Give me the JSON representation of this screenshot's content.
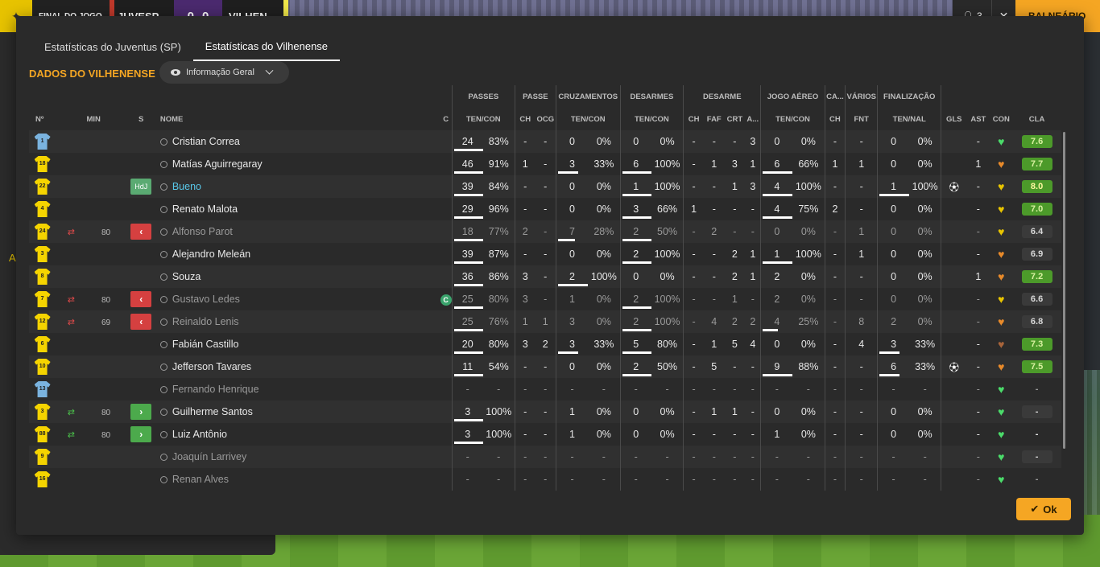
{
  "topbar": {
    "status": "FINAL DO JOGO",
    "home": "JUVESP",
    "home_score": "0",
    "away_score": "0",
    "away": "VILHEN",
    "people_count": "3",
    "dressing_room": "BALNEÁRIO"
  },
  "side_letter": "A",
  "tabs": [
    "Estatísticas do Juventus (SP)",
    "Estatísticas do Vilhenense"
  ],
  "active_tab": 1,
  "section_title": "DADOS DO VILHENENSE",
  "view_select": "Informação Geral",
  "group_headers": {
    "passes": "PASSES",
    "passe": "PASSE",
    "cruz": "CRUZAMENTOS",
    "desarmes": "DESARMES",
    "desarme": "DESARME",
    "aereo": "JOGO AÉREO",
    "ca": "CA...",
    "varios": "VÁRIOS",
    "final": "FINALIZAÇÃO"
  },
  "col_headers": {
    "n": "Nº",
    "min": "MIN",
    "s": "S",
    "nome": "NOME",
    "c": "C",
    "passes": "TEN/CON",
    "ch": "CH",
    "ocg": "OCG",
    "cruz": "TEN/CON",
    "des": "TEN/CON",
    "dch": "CH",
    "faf": "FAF",
    "crt": "CRT",
    "a": "A...",
    "aereo": "TEN/CON",
    "cach": "CH",
    "fnt": "FNT",
    "fin": "TEN/NAL",
    "gls": "GLS",
    "ast": "AST",
    "con": "CON",
    "cla": "CLA"
  },
  "players": [
    {
      "n": "1",
      "gk": true,
      "sub": "",
      "min": "",
      "s": "",
      "name": "Cristian Correa",
      "cap": false,
      "passes": [
        "24",
        "83%"
      ],
      "pbar": 83,
      "passe": [
        "-",
        "-"
      ],
      "cruz": [
        "0",
        "0%"
      ],
      "cbar": 0,
      "des": [
        "0",
        "0%"
      ],
      "dbar": 0,
      "desarme": [
        "-",
        "-",
        "-",
        "3"
      ],
      "aereo": [
        "0",
        "0%"
      ],
      "abar": 0,
      "ca": "-",
      "varios": "-",
      "fin": [
        "0",
        "0%"
      ],
      "fbar": 0,
      "gls": "",
      "ast": "-",
      "con": "green",
      "cla": "7.6",
      "clat": "good",
      "dim": false
    },
    {
      "n": "18",
      "gk": false,
      "sub": "",
      "min": "",
      "s": "",
      "name": "Matías Aguirregaray",
      "cap": false,
      "passes": [
        "46",
        "91%"
      ],
      "pbar": 91,
      "passe": [
        "1",
        "-"
      ],
      "cruz": [
        "3",
        "33%"
      ],
      "cbar": 33,
      "des": [
        "6",
        "100%"
      ],
      "dbar": 100,
      "desarme": [
        "-",
        "1",
        "3",
        "1"
      ],
      "aereo": [
        "6",
        "66%"
      ],
      "abar": 66,
      "ca": "1",
      "varios": "1",
      "fin": [
        "0",
        "0%"
      ],
      "fbar": 0,
      "gls": "",
      "ast": "1",
      "con": "orange",
      "cla": "7.7",
      "clat": "good",
      "dim": false
    },
    {
      "n": "22",
      "gk": false,
      "sub": "",
      "min": "",
      "s": "HdJ",
      "name": "Bueno",
      "cap": false,
      "blue": true,
      "passes": [
        "39",
        "84%"
      ],
      "pbar": 84,
      "passe": [
        "-",
        "-"
      ],
      "cruz": [
        "0",
        "0%"
      ],
      "cbar": 0,
      "des": [
        "1",
        "100%"
      ],
      "dbar": 100,
      "desarme": [
        "-",
        "-",
        "1",
        "3"
      ],
      "aereo": [
        "4",
        "100%"
      ],
      "abar": 100,
      "ca": "-",
      "varios": "-",
      "fin": [
        "1",
        "100%"
      ],
      "fbar": 100,
      "gls": "ball",
      "ast": "-",
      "con": "yellow",
      "cla": "8.0",
      "clat": "best",
      "dim": false
    },
    {
      "n": "4",
      "gk": false,
      "sub": "",
      "min": "",
      "s": "",
      "name": "Renato Malota",
      "cap": false,
      "passes": [
        "29",
        "96%"
      ],
      "pbar": 96,
      "passe": [
        "-",
        "-"
      ],
      "cruz": [
        "0",
        "0%"
      ],
      "cbar": 0,
      "des": [
        "3",
        "66%"
      ],
      "dbar": 66,
      "desarme": [
        "1",
        "-",
        "-",
        "-"
      ],
      "aereo": [
        "4",
        "75%"
      ],
      "abar": 75,
      "ca": "2",
      "varios": "-",
      "fin": [
        "0",
        "0%"
      ],
      "fbar": 0,
      "gls": "",
      "ast": "-",
      "con": "yellow",
      "cla": "7.0",
      "clat": "good",
      "dim": false
    },
    {
      "n": "24",
      "gk": false,
      "sub": "out",
      "min": "80",
      "s": "out",
      "name": "Alfonso Parot",
      "cap": false,
      "passes": [
        "18",
        "77%"
      ],
      "pbar": 77,
      "passe": [
        "2",
        "-"
      ],
      "cruz": [
        "7",
        "28%"
      ],
      "cbar": 28,
      "des": [
        "2",
        "50%"
      ],
      "dbar": 50,
      "desarme": [
        "-",
        "2",
        "-",
        "-"
      ],
      "aereo": [
        "0",
        "0%"
      ],
      "abar": 0,
      "ca": "-",
      "varios": "1",
      "fin": [
        "0",
        "0%"
      ],
      "fbar": 0,
      "gls": "",
      "ast": "-",
      "con": "yellow",
      "cla": "6.4",
      "clat": "mid",
      "dim": true
    },
    {
      "n": "3",
      "gk": false,
      "sub": "",
      "min": "",
      "s": "",
      "name": "Alejandro Meleán",
      "cap": false,
      "passes": [
        "39",
        "87%"
      ],
      "pbar": 87,
      "passe": [
        "-",
        "-"
      ],
      "cruz": [
        "0",
        "0%"
      ],
      "cbar": 0,
      "des": [
        "2",
        "100%"
      ],
      "dbar": 100,
      "desarme": [
        "-",
        "-",
        "2",
        "1"
      ],
      "aereo": [
        "1",
        "100%"
      ],
      "abar": 100,
      "ca": "-",
      "varios": "1",
      "fin": [
        "0",
        "0%"
      ],
      "fbar": 0,
      "gls": "",
      "ast": "-",
      "con": "orange",
      "cla": "6.9",
      "clat": "mid",
      "dim": false
    },
    {
      "n": "8",
      "gk": false,
      "sub": "",
      "min": "",
      "s": "",
      "name": "Souza",
      "cap": false,
      "passes": [
        "36",
        "86%"
      ],
      "pbar": 86,
      "passe": [
        "3",
        "-"
      ],
      "cruz": [
        "2",
        "100%"
      ],
      "cbar": 100,
      "des": [
        "0",
        "0%"
      ],
      "dbar": 0,
      "desarme": [
        "-",
        "-",
        "2",
        "1"
      ],
      "aereo": [
        "2",
        "0%"
      ],
      "abar": 0,
      "ca": "-",
      "varios": "-",
      "fin": [
        "0",
        "0%"
      ],
      "fbar": 0,
      "gls": "",
      "ast": "1",
      "con": "orange",
      "cla": "7.2",
      "clat": "good",
      "dim": false
    },
    {
      "n": "7",
      "gk": false,
      "sub": "out",
      "min": "80",
      "s": "out",
      "name": "Gustavo Ledes",
      "cap": true,
      "passes": [
        "25",
        "80%"
      ],
      "pbar": 80,
      "passe": [
        "3",
        "-"
      ],
      "cruz": [
        "1",
        "0%"
      ],
      "cbar": 0,
      "des": [
        "2",
        "100%"
      ],
      "dbar": 100,
      "desarme": [
        "-",
        "-",
        "1",
        "-"
      ],
      "aereo": [
        "2",
        "0%"
      ],
      "abar": 0,
      "ca": "-",
      "varios": "-",
      "fin": [
        "0",
        "0%"
      ],
      "fbar": 0,
      "gls": "",
      "ast": "-",
      "con": "yellow",
      "cla": "6.6",
      "clat": "mid",
      "dim": true
    },
    {
      "n": "12",
      "gk": false,
      "sub": "out",
      "min": "69",
      "s": "out",
      "name": "Reinaldo Lenis",
      "cap": false,
      "passes": [
        "25",
        "76%"
      ],
      "pbar": 76,
      "passe": [
        "1",
        "1"
      ],
      "cruz": [
        "3",
        "0%"
      ],
      "cbar": 0,
      "des": [
        "2",
        "100%"
      ],
      "dbar": 100,
      "desarme": [
        "-",
        "4",
        "2",
        "2"
      ],
      "aereo": [
        "4",
        "25%"
      ],
      "abar": 25,
      "ca": "-",
      "varios": "8",
      "fin": [
        "2",
        "0%"
      ],
      "fbar": 0,
      "gls": "",
      "ast": "-",
      "con": "orange",
      "cla": "6.8",
      "clat": "mid",
      "dim": true
    },
    {
      "n": "6",
      "gk": false,
      "sub": "",
      "min": "",
      "s": "",
      "name": "Fabián Castillo",
      "cap": false,
      "passes": [
        "20",
        "80%"
      ],
      "pbar": 80,
      "passe": [
        "3",
        "2"
      ],
      "cruz": [
        "3",
        "33%"
      ],
      "cbar": 33,
      "des": [
        "5",
        "80%"
      ],
      "dbar": 80,
      "desarme": [
        "-",
        "1",
        "5",
        "4"
      ],
      "aereo": [
        "0",
        "0%"
      ],
      "abar": 0,
      "ca": "-",
      "varios": "4",
      "fin": [
        "3",
        "33%"
      ],
      "fbar": 33,
      "gls": "",
      "ast": "-",
      "con": "brown",
      "cla": "7.3",
      "clat": "good",
      "dim": false
    },
    {
      "n": "10",
      "gk": false,
      "sub": "",
      "min": "",
      "s": "",
      "name": "Jefferson Tavares",
      "cap": false,
      "passes": [
        "11",
        "54%"
      ],
      "pbar": 54,
      "passe": [
        "-",
        "-"
      ],
      "cruz": [
        "0",
        "0%"
      ],
      "cbar": 0,
      "des": [
        "2",
        "50%"
      ],
      "dbar": 50,
      "desarme": [
        "-",
        "5",
        "-",
        "-"
      ],
      "aereo": [
        "9",
        "88%"
      ],
      "abar": 88,
      "ca": "-",
      "varios": "-",
      "fin": [
        "6",
        "33%"
      ],
      "fbar": 33,
      "gls": "ball",
      "ast": "-",
      "con": "orange",
      "cla": "7.5",
      "clat": "good",
      "dim": false
    },
    {
      "n": "13",
      "gk": true,
      "sub": "",
      "min": "",
      "s": "",
      "name": "Fernando Henrique",
      "cap": false,
      "passes": [
        "-",
        "-"
      ],
      "pbar": 0,
      "passe": [
        "-",
        "-"
      ],
      "cruz": [
        "-",
        "-"
      ],
      "cbar": 0,
      "des": [
        "-",
        "-"
      ],
      "dbar": 0,
      "desarme": [
        "-",
        "-",
        "-",
        "-"
      ],
      "aereo": [
        "-",
        "-"
      ],
      "abar": 0,
      "ca": "-",
      "varios": "-",
      "fin": [
        "-",
        "-"
      ],
      "fbar": 0,
      "gls": "",
      "ast": "-",
      "con": "green",
      "cla": "-",
      "clat": "none",
      "dim": true
    },
    {
      "n": "3",
      "gk": false,
      "sub": "in",
      "min": "80",
      "s": "in",
      "name": "Guilherme Santos",
      "cap": false,
      "passes": [
        "3",
        "100%"
      ],
      "pbar": 100,
      "passe": [
        "-",
        "-"
      ],
      "cruz": [
        "1",
        "0%"
      ],
      "cbar": 0,
      "des": [
        "0",
        "0%"
      ],
      "dbar": 0,
      "desarme": [
        "-",
        "1",
        "1",
        "-"
      ],
      "aereo": [
        "0",
        "0%"
      ],
      "abar": 0,
      "ca": "-",
      "varios": "-",
      "fin": [
        "0",
        "0%"
      ],
      "fbar": 0,
      "gls": "",
      "ast": "-",
      "con": "green",
      "cla": "-",
      "clat": "mid",
      "dim": false
    },
    {
      "n": "88",
      "gk": false,
      "sub": "in",
      "min": "80",
      "s": "in",
      "name": "Luiz Antônio",
      "cap": false,
      "passes": [
        "3",
        "100%"
      ],
      "pbar": 100,
      "passe": [
        "-",
        "-"
      ],
      "cruz": [
        "1",
        "0%"
      ],
      "cbar": 0,
      "des": [
        "0",
        "0%"
      ],
      "dbar": 0,
      "desarme": [
        "-",
        "-",
        "-",
        "-"
      ],
      "aereo": [
        "1",
        "0%"
      ],
      "abar": 0,
      "ca": "-",
      "varios": "-",
      "fin": [
        "0",
        "0%"
      ],
      "fbar": 0,
      "gls": "",
      "ast": "-",
      "con": "green",
      "cla": "-",
      "clat": "none",
      "dim": false
    },
    {
      "n": "9",
      "gk": false,
      "sub": "",
      "min": "",
      "s": "",
      "name": "Joaquín Larrivey",
      "cap": false,
      "passes": [
        "-",
        "-"
      ],
      "pbar": 0,
      "passe": [
        "-",
        "-"
      ],
      "cruz": [
        "-",
        "-"
      ],
      "cbar": 0,
      "des": [
        "-",
        "-"
      ],
      "dbar": 0,
      "desarme": [
        "-",
        "-",
        "-",
        "-"
      ],
      "aereo": [
        "-",
        "-"
      ],
      "abar": 0,
      "ca": "-",
      "varios": "-",
      "fin": [
        "-",
        "-"
      ],
      "fbar": 0,
      "gls": "",
      "ast": "-",
      "con": "green",
      "cla": "-",
      "clat": "mid",
      "dim": true
    },
    {
      "n": "16",
      "gk": false,
      "sub": "",
      "min": "",
      "s": "",
      "name": "Renan Alves",
      "cap": false,
      "passes": [
        "-",
        "-"
      ],
      "pbar": 0,
      "passe": [
        "-",
        "-"
      ],
      "cruz": [
        "-",
        "-"
      ],
      "cbar": 0,
      "des": [
        "-",
        "-"
      ],
      "dbar": 0,
      "desarme": [
        "-",
        "-",
        "-",
        "-"
      ],
      "aereo": [
        "-",
        "-"
      ],
      "abar": 0,
      "ca": "-",
      "varios": "-",
      "fin": [
        "-",
        "-"
      ],
      "fbar": 0,
      "gls": "",
      "ast": "-",
      "con": "green",
      "cla": "-",
      "clat": "none",
      "dim": true
    }
  ],
  "ok_label": "Ok",
  "colors": {
    "accent": "#f5a623",
    "green": "#4bdb6a",
    "yellow": "#e8c400",
    "orange": "#e88a2a",
    "brown": "#a8643a"
  }
}
